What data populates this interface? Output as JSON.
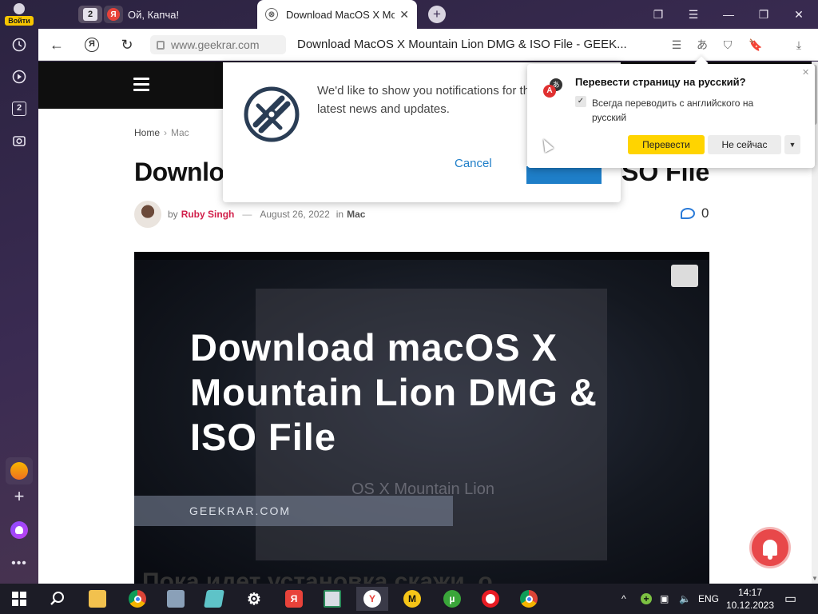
{
  "sidebar": {
    "login_label": "Войти",
    "tab_count_badge": "2",
    "icons": [
      "history-icon",
      "play-icon",
      "tab-count-icon",
      "camera-icon",
      "orange-app-icon",
      "add-icon",
      "alice-icon",
      "more-icon"
    ]
  },
  "tabs": {
    "count": "2",
    "items": [
      {
        "title": "Ой, Капча!",
        "favicon": "Я",
        "favicon_color": "#e8423a",
        "active": false
      },
      {
        "title": "Download MacOS X Mountain Lion DMG & ISO File - GEEKRAR",
        "favicon": "⊗",
        "favicon_color": "#666666",
        "active": true
      }
    ]
  },
  "address_bar": {
    "domain": "www.geekrar.com",
    "page_title": "Download MacOS X Mountain Lion DMG & ISO File - GEEK..."
  },
  "page": {
    "breadcrumb": {
      "home": "Home",
      "current": "Mac"
    },
    "headline_start": "Downloa",
    "headline_end": "SO File",
    "meta": {
      "by": "by",
      "author": "Ruby Singh",
      "dash": "—",
      "date": "August 26, 2022",
      "in": "in",
      "category": "Mac"
    },
    "comment_count": "0",
    "hero": {
      "title": "Download macOS X Mountain Lion DMG & ISO File",
      "brand": "GEEKRAR.COM",
      "ghost_text": "OS X Mountain Lion"
    },
    "behind_text": "Пока идет установка скажи, о"
  },
  "notification_popup": {
    "message": "We'd like to show you notifications for the latest news and updates.",
    "cancel_label": "Cancel",
    "allow_label": ""
  },
  "translate_popup": {
    "title": "Перевести страницу на русский?",
    "checkbox_label": "Всегда переводить с английского на русский",
    "translate_button": "Перевести",
    "not_now_button": "Не сейчас"
  },
  "taskbar": {
    "language": "ENG",
    "time": "14:17",
    "date": "10.12.2023"
  },
  "colors": {
    "accent_yellow": "#ffd400",
    "author_red": "#d11f4a",
    "link_blue": "#1e7ec8",
    "bell_red": "#e8484a"
  }
}
